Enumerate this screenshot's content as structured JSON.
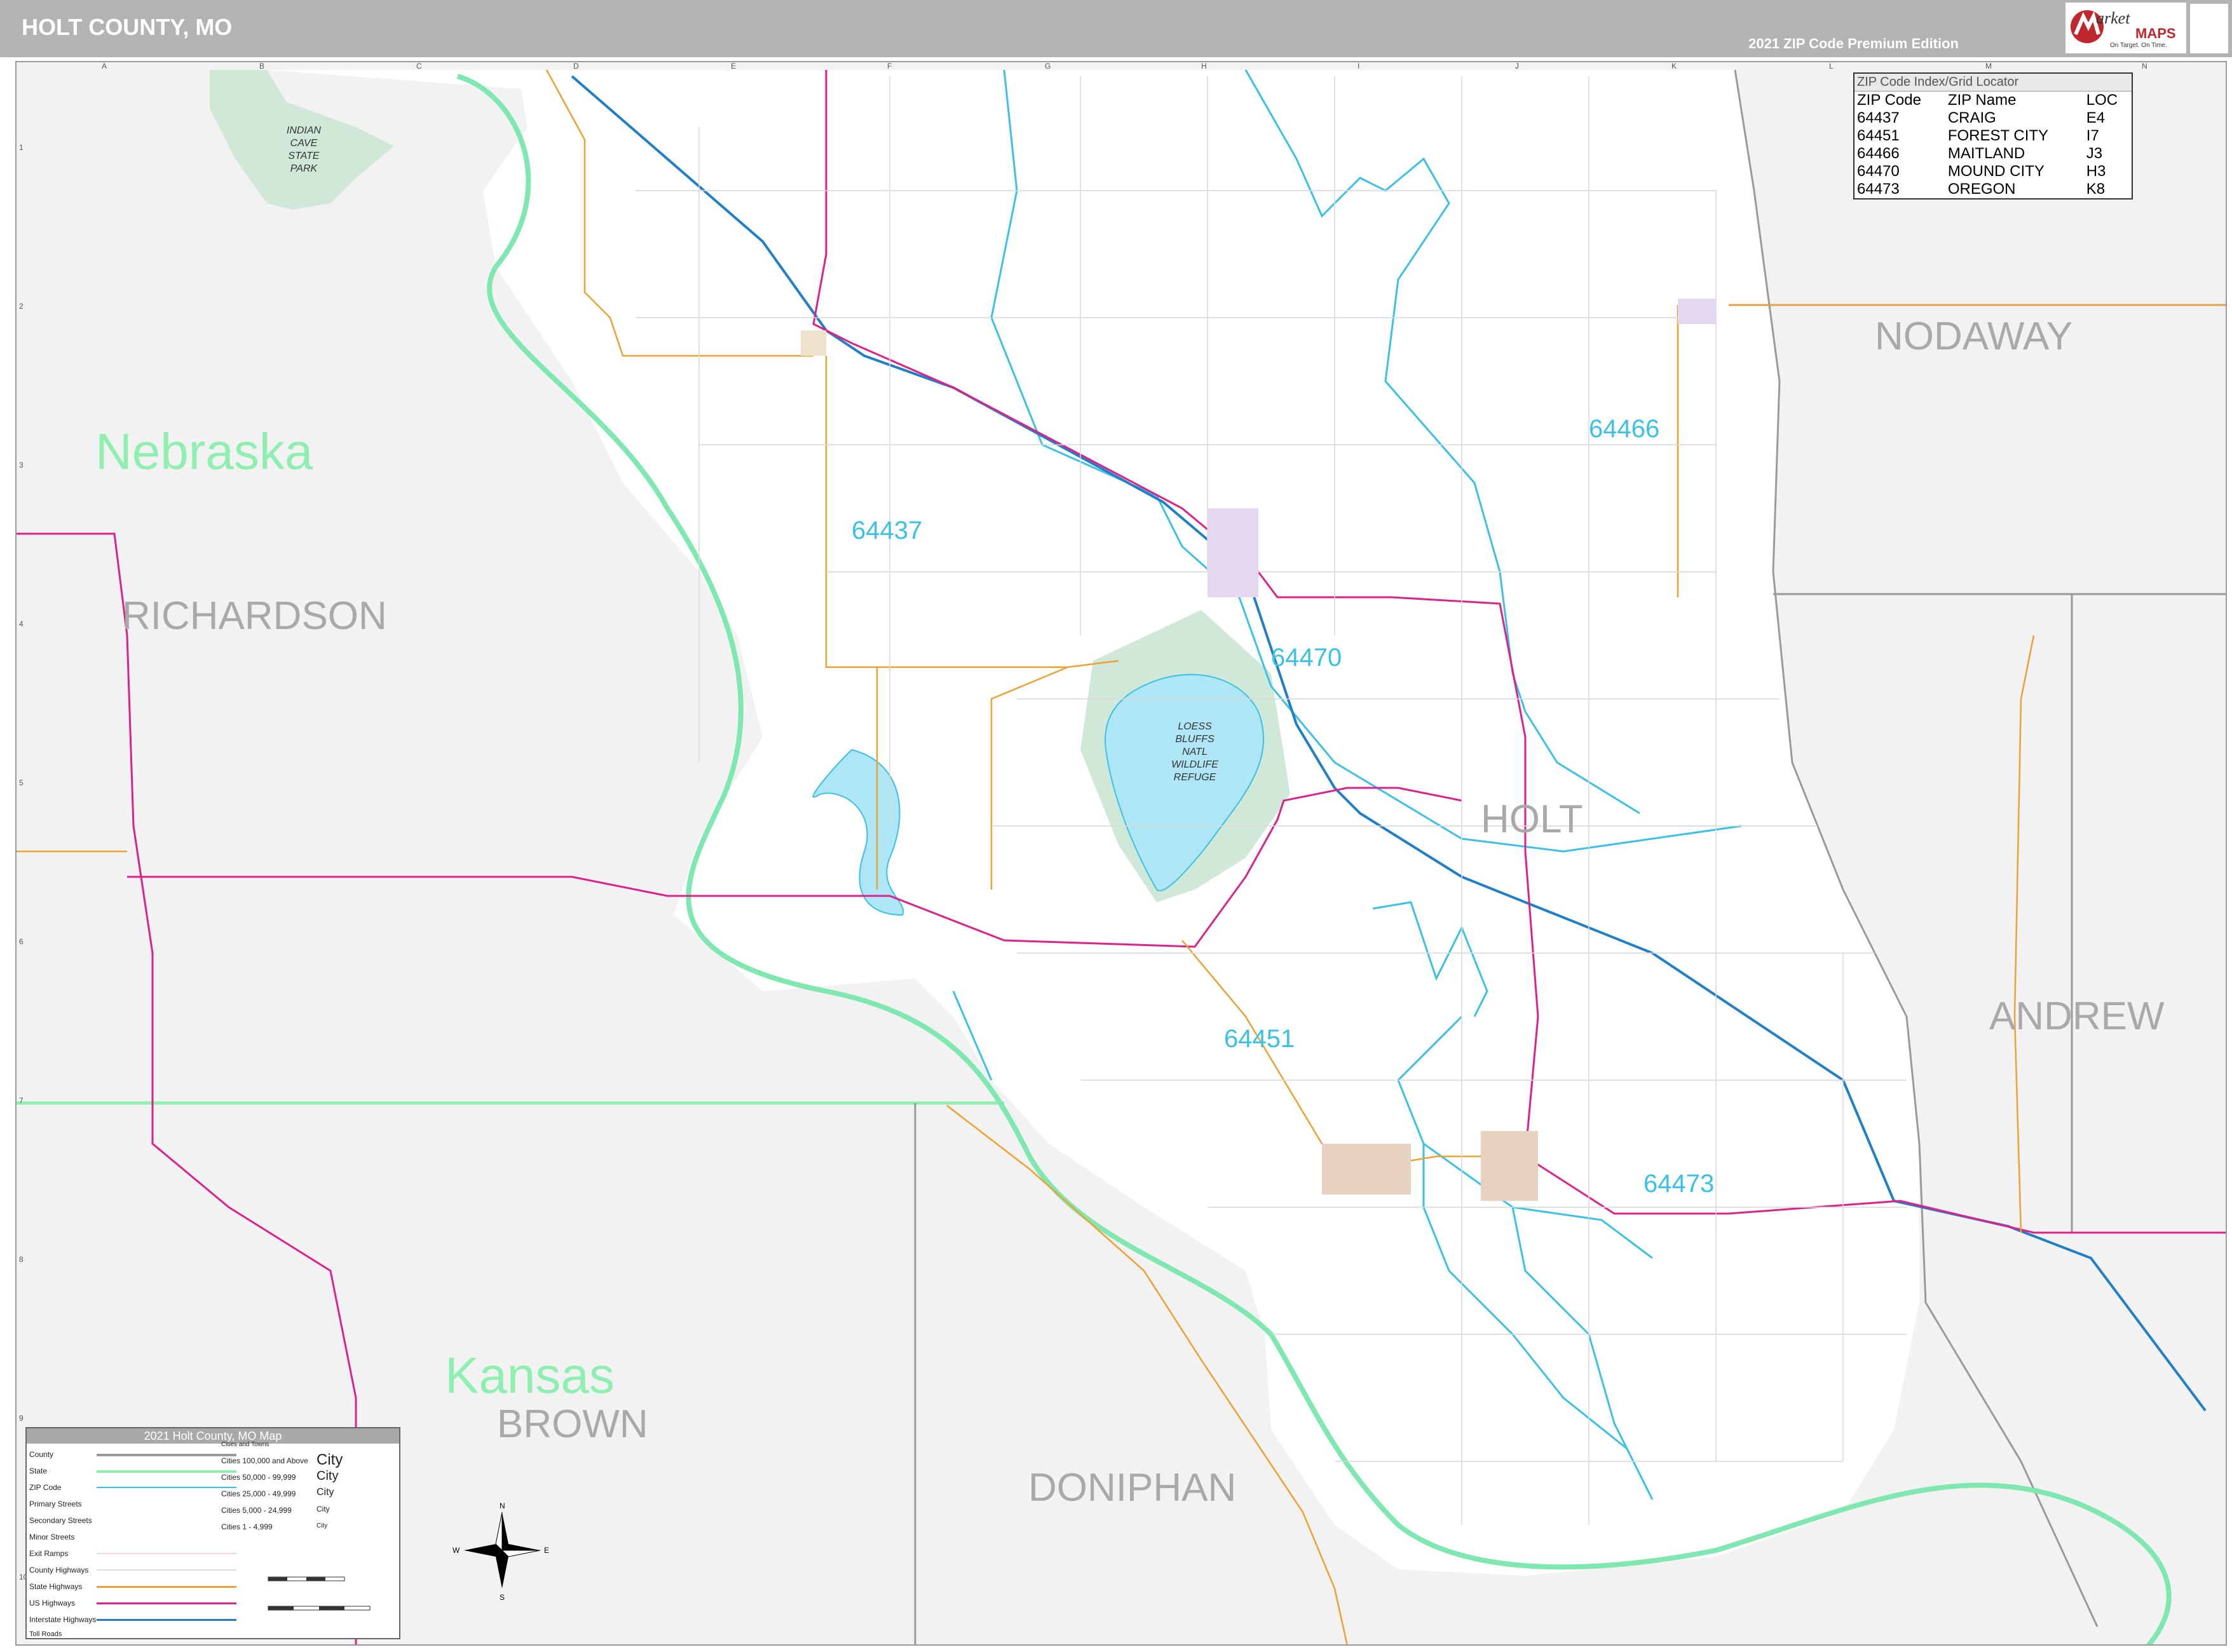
{
  "header": {
    "title": "HOLT COUNTY, MO",
    "edition": "2021 ZIP Code Premium Edition",
    "logo": {
      "brand_top": "arket",
      "brand_bottom": "MAPS",
      "tagline": "On Target. On Time."
    }
  },
  "grid": {
    "columns": [
      "A",
      "B",
      "C",
      "D",
      "E",
      "F",
      "G",
      "H",
      "I",
      "J",
      "K",
      "L",
      "M",
      "N"
    ],
    "rows": [
      "1",
      "2",
      "3",
      "4",
      "5",
      "6",
      "7",
      "8",
      "9",
      "10"
    ]
  },
  "labels": {
    "states": [
      "Nebraska",
      "Kansas"
    ],
    "counties": [
      "RICHARDSON",
      "NODAWAY",
      "ANDREW",
      "HOLT",
      "BROWN",
      "DONIPHAN"
    ],
    "park": [
      "INDIAN",
      "CAVE",
      "STATE",
      "PARK"
    ],
    "refuge": [
      "LOESS",
      "BLUFFS",
      "NATL",
      "WILDLIFE",
      "REFUGE"
    ],
    "zips": [
      "64437",
      "64466",
      "64470",
      "64451",
      "64473"
    ]
  },
  "zip_index": {
    "title": "ZIP Code Index/Grid Locator",
    "headers": [
      "ZIP Code",
      "ZIP Name",
      "LOC"
    ],
    "rows": [
      [
        "64437",
        "CRAIG",
        "E4"
      ],
      [
        "64451",
        "FOREST CITY",
        "I7"
      ],
      [
        "64466",
        "MAITLAND",
        "J3"
      ],
      [
        "64470",
        "MOUND CITY",
        "H3"
      ],
      [
        "64473",
        "OREGON",
        "K8"
      ]
    ]
  },
  "legend": {
    "title": "2021 Holt County, MO Map",
    "items": [
      "County",
      "State",
      "ZIP Code",
      "Primary Streets",
      "Secondary Streets",
      "Minor Streets",
      "Exit Ramps",
      "County Highways",
      "State Highways",
      "US Highways",
      "Interstate Highways",
      "Toll Roads"
    ],
    "cities_header": "Cities and Towns",
    "cities": [
      "Cities 100,000 and Above",
      "Cities 50,000 - 99,999",
      "Cities 25,000 - 49,999",
      "Cities 5,000 - 24,999",
      "Cities 1 - 4,999"
    ],
    "city_samples": [
      "City",
      "City",
      "City",
      "City",
      "City"
    ],
    "colors": {
      "county": "#9a9a9a",
      "state": "#8fefb0",
      "zip": "#39c2e6",
      "county_hwy": "#dddddd",
      "state_hwy": "#f0a030",
      "us_hwy": "#e0208a",
      "interstate": "#1f7fc7",
      "toll": "#2ea84a"
    }
  },
  "colors": {
    "water": "#aee6f5",
    "river": "#7fe8b0",
    "park": "#cfe8d8",
    "outside": "#f2f2f2",
    "interstate": "#1f7fc7",
    "us_highway": "#e0208a",
    "state_highway": "#f0a030",
    "zip_boundary": "#39c2e6"
  }
}
